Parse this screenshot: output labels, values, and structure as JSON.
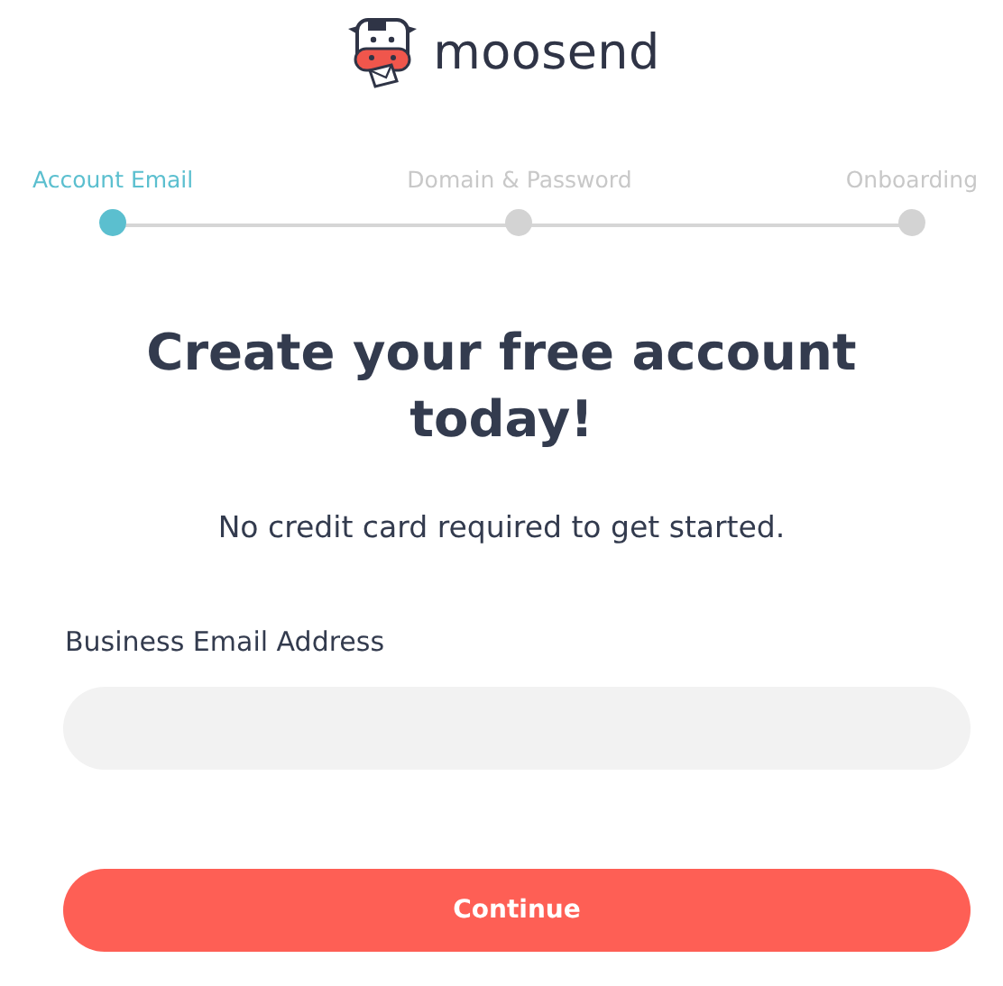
{
  "logo": {
    "text": "moosend"
  },
  "steps": [
    {
      "label": "Account Email",
      "selected": true
    },
    {
      "label": "Domain & Password",
      "selected": false
    },
    {
      "label": "Onboarding",
      "selected": false
    }
  ],
  "heading": "Create your free account today!",
  "subtitle": "No credit card required to get started.",
  "email_field": {
    "label": "Business Email Address"
  },
  "buttons": [
    {
      "label": "Continue"
    }
  ]
}
